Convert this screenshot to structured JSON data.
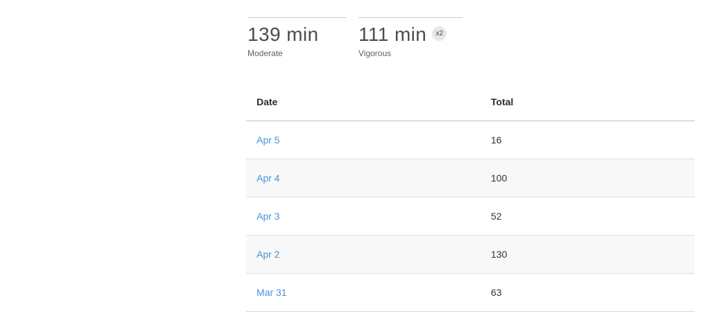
{
  "stats": [
    {
      "value": "139 min",
      "label": "Moderate"
    },
    {
      "value": "111 min",
      "label": "Vigorous",
      "badge": "x2"
    }
  ],
  "table": {
    "columns": [
      "Date",
      "Total"
    ],
    "rows": [
      {
        "date": "Apr 5",
        "total": "16"
      },
      {
        "date": "Apr 4",
        "total": "100"
      },
      {
        "date": "Apr 3",
        "total": "52"
      },
      {
        "date": "Apr 2",
        "total": "130"
      },
      {
        "date": "Mar 31",
        "total": "63"
      }
    ]
  },
  "colors": {
    "link_blue": "#4a90d9",
    "badge_background": "#e7e7e7",
    "zebra_row": "#f8f8f8",
    "stat_value_text": "#4c4c4c"
  }
}
